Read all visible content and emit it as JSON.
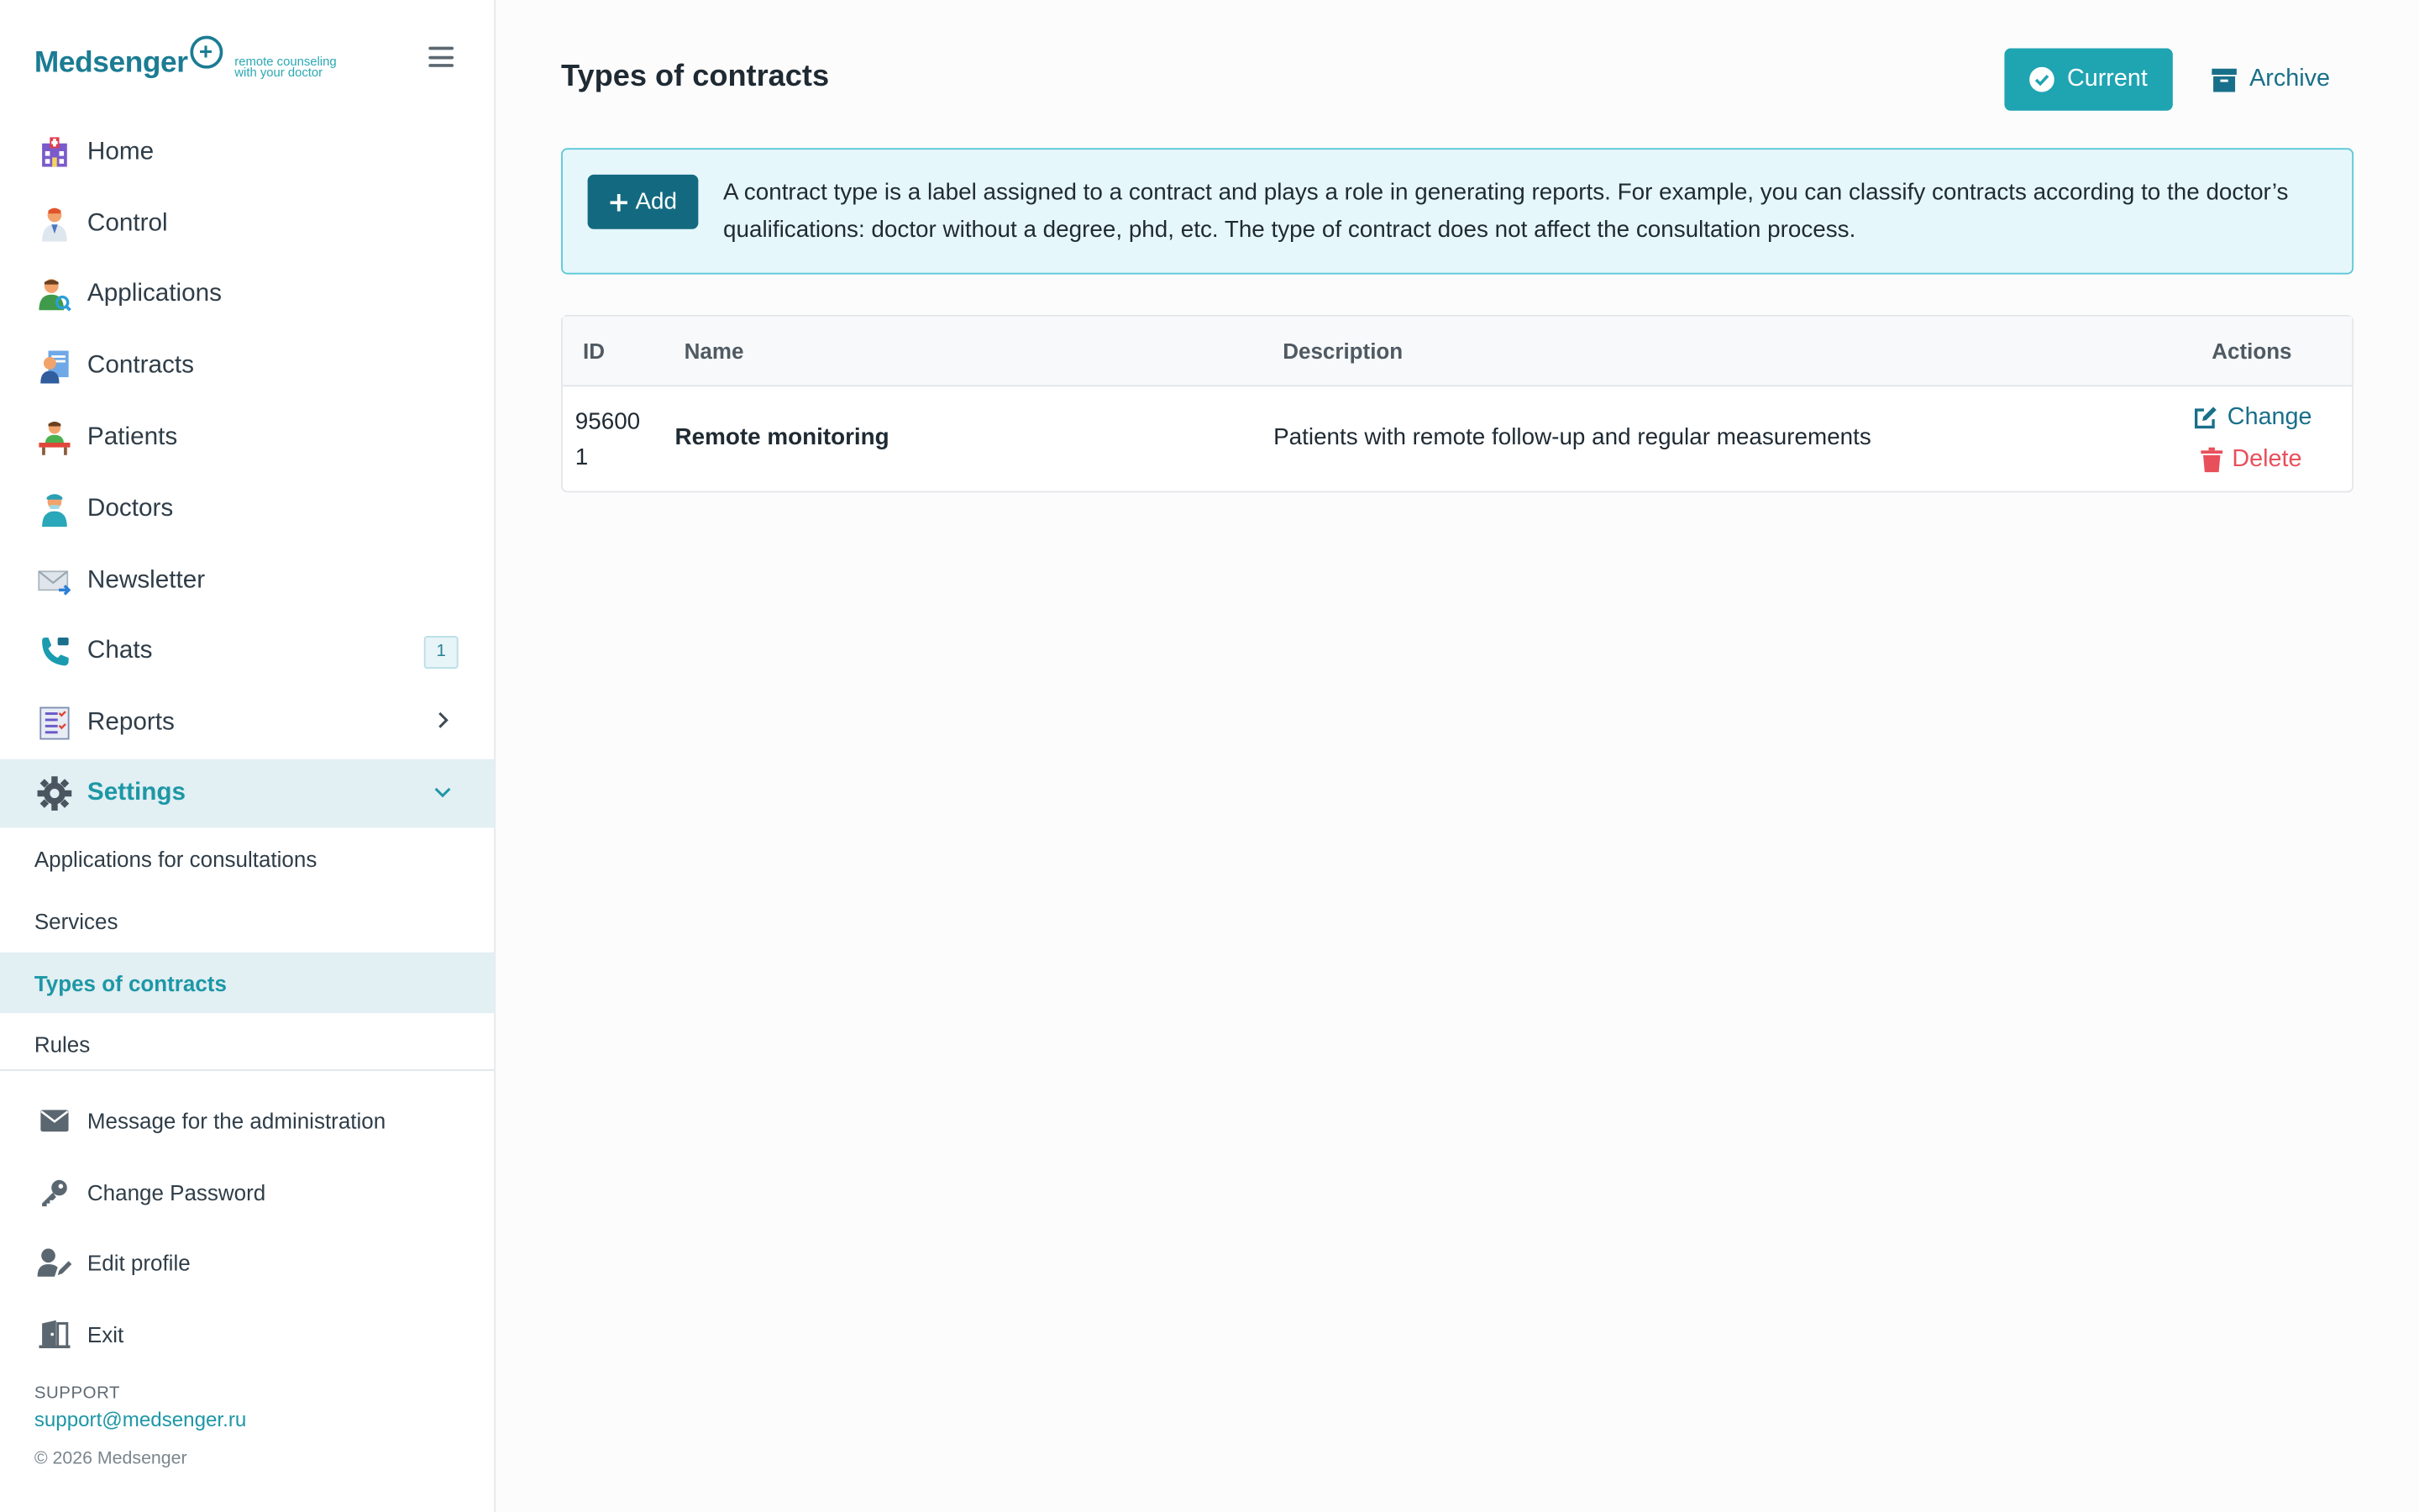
{
  "logo": {
    "word": "Medsenger",
    "tagline_1": "remote counseling",
    "tagline_2": "with your doctor"
  },
  "sidebar": {
    "items": [
      {
        "label": "Home",
        "icon": "hospital-icon"
      },
      {
        "label": "Control",
        "icon": "doctor-icon"
      },
      {
        "label": "Applications",
        "icon": "user-search-icon"
      },
      {
        "label": "Contracts",
        "icon": "contract-icon"
      },
      {
        "label": "Patients",
        "icon": "patient-icon"
      },
      {
        "label": "Doctors",
        "icon": "nurse-icon"
      },
      {
        "label": "Newsletter",
        "icon": "envelope-icon"
      },
      {
        "label": "Chats",
        "icon": "phone-icon",
        "badge": "1"
      },
      {
        "label": "Reports",
        "icon": "report-icon"
      },
      {
        "label": "Settings",
        "icon": "gear-icon"
      }
    ],
    "settings_sub": [
      {
        "label": "Applications for consultations"
      },
      {
        "label": "Services"
      },
      {
        "label": "Types of contracts"
      },
      {
        "label": "Rules"
      }
    ],
    "bottom": [
      {
        "label": "Message for the administration",
        "icon": "mail-icon"
      },
      {
        "label": "Change Password",
        "icon": "key-icon"
      },
      {
        "label": "Edit profile",
        "icon": "user-edit-icon"
      },
      {
        "label": "Exit",
        "icon": "door-icon"
      }
    ],
    "support_heading": "SUPPORT",
    "support_email": "support@medsenger.ru",
    "copyright": "© 2026 Medsenger"
  },
  "main": {
    "title": "Types of contracts",
    "current_label": "Current",
    "archive_label": "Archive",
    "add_label": "Add",
    "info_text": "A contract type is a label assigned to a contract and plays a role in generating reports. For example, you can classify contracts according to the doctor’s qualifications: doctor without a degree, phd, etc. The type of contract does not affect the consultation process.",
    "table": {
      "headers": {
        "id": "ID",
        "name": "Name",
        "description": "Description",
        "actions": "Actions"
      },
      "rows": [
        {
          "id_line1": "95600",
          "id_line2": "1",
          "name": "Remote monitoring",
          "description": "Patients with remote follow-up and regular measurements",
          "change": "Change",
          "delete": "Delete"
        }
      ]
    }
  },
  "colors": {
    "accent": "#1fa4b2",
    "brand": "#1b7c93",
    "dark_button": "#136a80",
    "danger": "#e8505b"
  }
}
